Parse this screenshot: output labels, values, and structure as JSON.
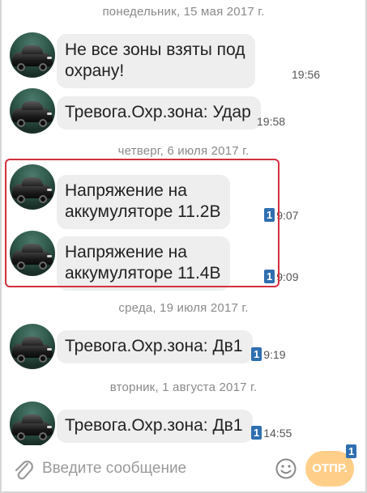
{
  "colors": {
    "bubble": "#eeeeee",
    "badge": "#2f6fb0",
    "highlight": "#d32f3f",
    "send_button": "#ffcf8a"
  },
  "dates": [
    "понедельник, 15 мая 2017 г.",
    "четверг, 6 июля 2017 г.",
    "среда, 19 июля 2017 г.",
    "вторник, 1 августа 2017 г."
  ],
  "messages": [
    {
      "line1": "Не все зоны взяты под",
      "line2": "охрану!",
      "time": "19:56",
      "badge": ""
    },
    {
      "line1": "Тревога.Охр.зона: Удар",
      "line2": "",
      "time": "19:58",
      "badge": ""
    },
    {
      "line1": "Напряжение на",
      "line2": "аккумуляторе 11.2В",
      "time": "9:07",
      "badge": "1"
    },
    {
      "line1": "Напряжение на",
      "line2": "аккумуляторе 11.4В",
      "time": "9:09",
      "badge": "1"
    },
    {
      "line1": "Тревога.Охр.зона: Дв1",
      "line2": "",
      "time": "9:19",
      "badge": "1"
    },
    {
      "line1": "Тревога.Охр.зона: Дв1",
      "line2": "",
      "time": "14:55",
      "badge": "1"
    }
  ],
  "composer": {
    "placeholder": "Введите сообщение",
    "send_label": "ОТПР.",
    "send_badge": "1",
    "attach_icon": "paperclip-icon",
    "emoji_icon": "smiley-icon"
  }
}
